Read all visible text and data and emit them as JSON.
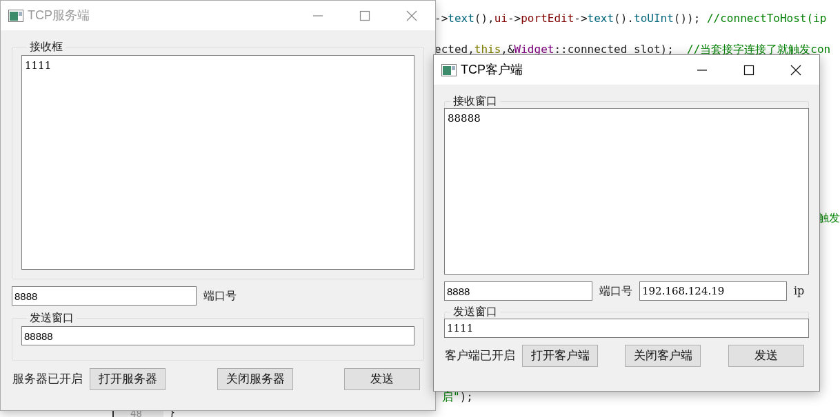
{
  "code_editor": {
    "lines": [
      {
        "segments": [
          {
            "text": "->",
            "kind": "plain"
          },
          {
            "text": "text",
            "kind": "method"
          },
          {
            "text": "(),",
            "kind": "plain"
          },
          {
            "text": "ui",
            "kind": "member"
          },
          {
            "text": "->",
            "kind": "plain"
          },
          {
            "text": "portEdit",
            "kind": "member"
          },
          {
            "text": "->",
            "kind": "plain"
          },
          {
            "text": "text",
            "kind": "method"
          },
          {
            "text": "().",
            "kind": "plain"
          },
          {
            "text": "toUInt",
            "kind": "method"
          },
          {
            "text": "()); ",
            "kind": "plain"
          },
          {
            "text": "//connectToHost(ip",
            "kind": "comment"
          }
        ]
      },
      {
        "segments": [
          {
            "text": "ected,",
            "kind": "plain"
          },
          {
            "text": "this",
            "kind": "keyword"
          },
          {
            "text": ",&",
            "kind": "plain"
          },
          {
            "text": "Widget",
            "kind": "type"
          },
          {
            "text": "::connected_slot);  ",
            "kind": "plain"
          },
          {
            "text": "//当套接字连接了就触发con",
            "kind": "comment"
          }
        ]
      },
      {
        "segments": [
          {
            "text": "触发",
            "kind": "comment"
          }
        ]
      },
      {
        "segments": [
          {
            "text": "启\"",
            "kind": "comment"
          },
          {
            "text": ");",
            "kind": "plain"
          }
        ]
      }
    ],
    "line_numbers": [
      "48"
    ],
    "brace": "}"
  },
  "server_window": {
    "title": "TCP服务端",
    "active": false,
    "receive_group": {
      "title": "接收框",
      "text": "1111"
    },
    "port": {
      "value": "8888",
      "label": "端口号"
    },
    "send_group": {
      "title": "发送窗口",
      "value": "88888"
    },
    "status": "服务器已开启",
    "buttons": [
      "打开服务器",
      "关闭服务器",
      "发送"
    ]
  },
  "client_window": {
    "title": "TCP客户端",
    "active": true,
    "receive_group": {
      "title": "接收窗口",
      "text": "88888"
    },
    "port": {
      "value": "8888",
      "label": "端口号"
    },
    "ip": {
      "value": "192.168.124.19",
      "label": "ip"
    },
    "send_group": {
      "title": "发送窗口",
      "value": "1111"
    },
    "status": "客户端已开启",
    "buttons": [
      "打开客户端",
      "关闭客户端",
      "发送"
    ]
  }
}
